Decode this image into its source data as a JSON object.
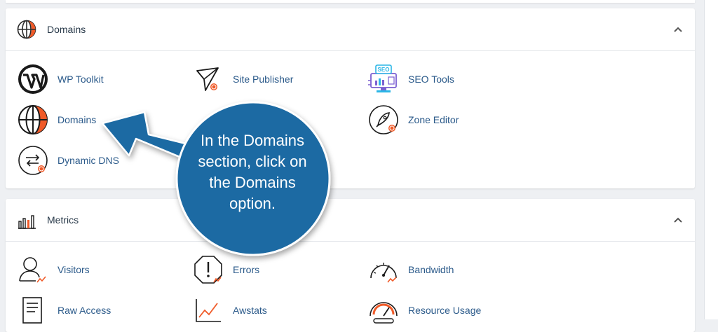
{
  "colors": {
    "accent_orange": "#f05a28",
    "link_blue": "#2b5a8a",
    "callout_blue": "#1d6aa3",
    "seo_purple": "#7b5fd1",
    "seo_cyan": "#2bb6e6"
  },
  "domains_panel": {
    "title": "Domains",
    "icon": "globe-icon",
    "items": [
      {
        "label": "WP Toolkit",
        "icon": "wordpress-icon"
      },
      {
        "label": "Site Publisher",
        "icon": "paper-plane-icon"
      },
      {
        "label": "SEO Tools",
        "icon": "seo-monitor-icon"
      },
      {
        "label": "Domains",
        "icon": "globe-icon"
      },
      {
        "label": "Zone Editor",
        "icon": "rocket-icon"
      },
      {
        "label": "Dynamic DNS",
        "icon": "exchange-arrows-icon"
      }
    ]
  },
  "metrics_panel": {
    "title": "Metrics",
    "icon": "bar-chart-icon",
    "items": [
      {
        "label": "Visitors",
        "icon": "user-chart-icon"
      },
      {
        "label": "Errors",
        "icon": "error-octagon-icon"
      },
      {
        "label": "Bandwidth",
        "icon": "gauge-icon"
      },
      {
        "label": "Raw Access",
        "icon": "document-icon"
      },
      {
        "label": "Awstats",
        "icon": "line-chart-icon"
      },
      {
        "label": "Resource Usage",
        "icon": "speedometer-icon"
      }
    ]
  },
  "callout": {
    "lines": [
      "In the Domains",
      "section, click on",
      "the Domains",
      "option."
    ]
  }
}
